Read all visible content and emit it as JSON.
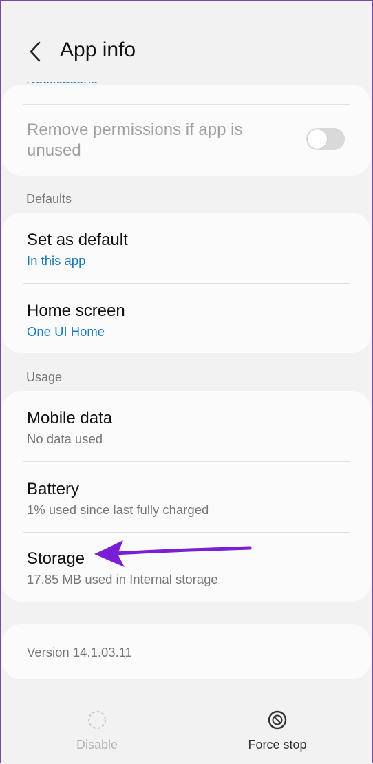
{
  "header": {
    "title": "App info",
    "peek_label": "Notifications"
  },
  "permissions_card": {
    "remove_permissions_label": "Remove permissions if app is unused",
    "toggle_state": "off"
  },
  "defaults": {
    "section_label": "Defaults",
    "set_as_default": {
      "title": "Set as default",
      "subtitle": "In this app"
    },
    "home_screen": {
      "title": "Home screen",
      "subtitle": "One UI Home"
    }
  },
  "usage": {
    "section_label": "Usage",
    "mobile_data": {
      "title": "Mobile data",
      "subtitle": "No data used"
    },
    "battery": {
      "title": "Battery",
      "subtitle": "1% used since last fully charged"
    },
    "storage": {
      "title": "Storage",
      "subtitle": "17.85 MB used in Internal storage"
    }
  },
  "version": {
    "label": "Version 14.1.03.11"
  },
  "bottom_bar": {
    "disable_label": "Disable",
    "force_stop_label": "Force stop"
  },
  "colors": {
    "accent_link": "#1b7bbf",
    "annotation_arrow": "#7b1fd6"
  }
}
